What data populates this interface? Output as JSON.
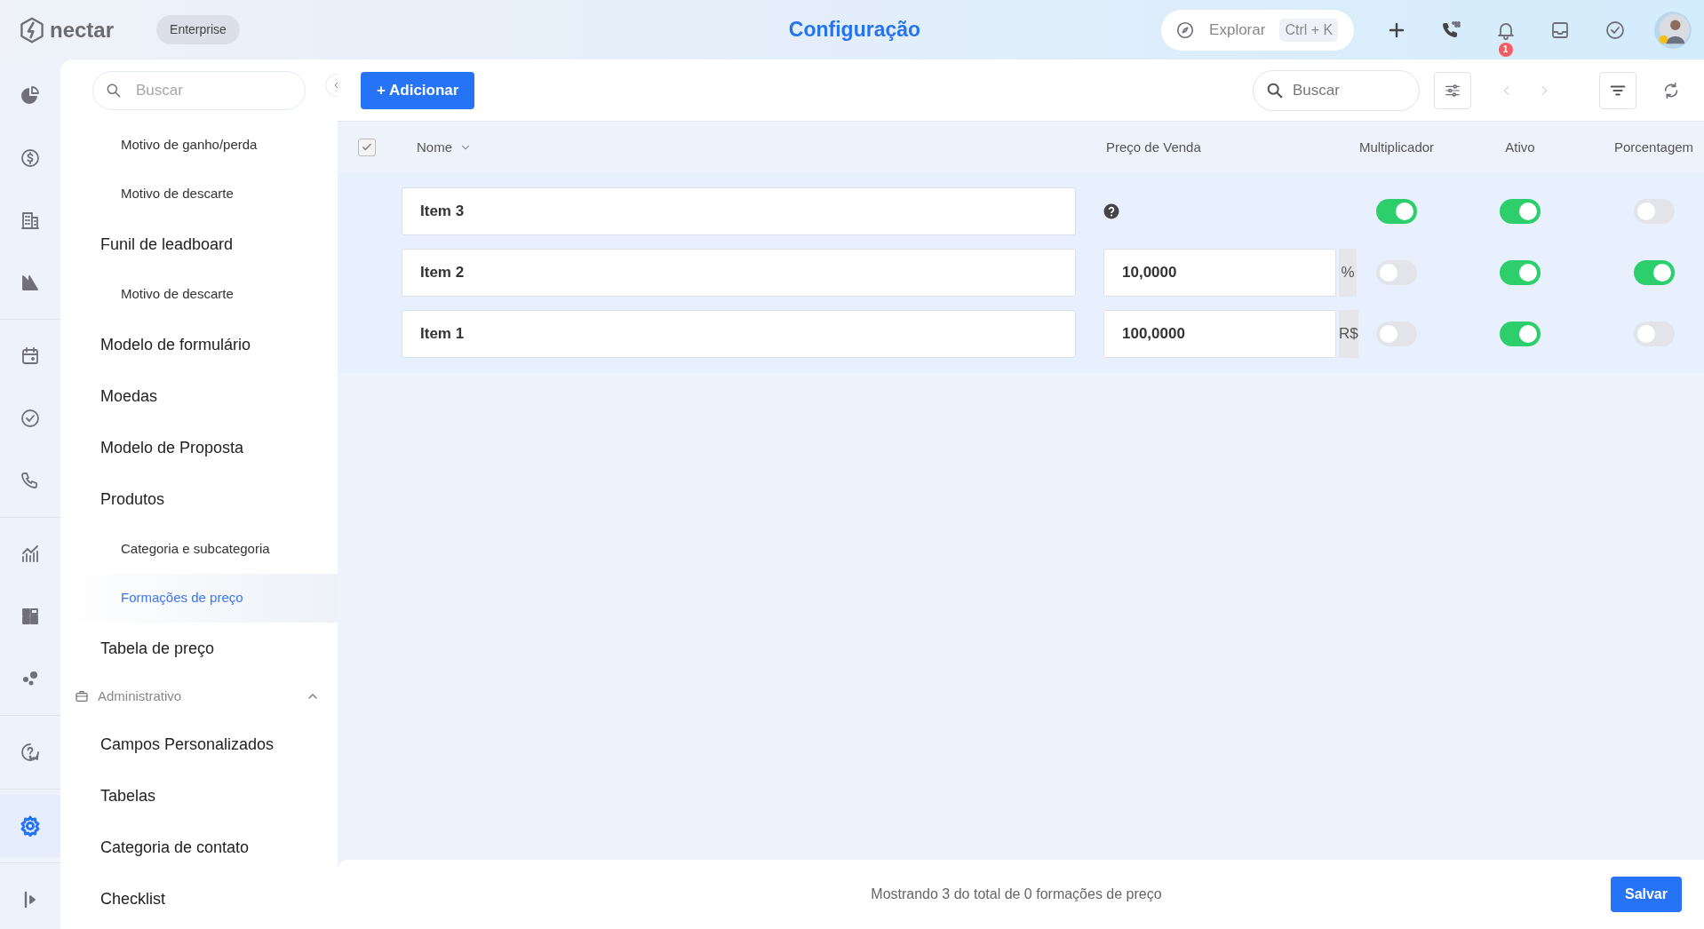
{
  "topbar": {
    "brand": "nectar",
    "plan": "Enterprise",
    "title": "Configuração",
    "explore": {
      "placeholder": "Explorar",
      "shortcut": "Ctrl + K"
    },
    "notifications": "1"
  },
  "rail": [
    [
      {
        "selected": false
      },
      {
        "selected": false
      },
      {
        "selected": false
      },
      {
        "selected": false
      }
    ],
    [
      {
        "selected": false
      },
      {
        "selected": false
      },
      {
        "selected": false
      }
    ],
    [
      {
        "selected": false
      },
      {
        "selected": false
      },
      {
        "selected": false
      }
    ],
    [
      {
        "selected": false
      }
    ],
    [
      {
        "selected": true
      }
    ],
    [
      {
        "selected": false
      }
    ]
  ],
  "sidebar": {
    "search": {
      "placeholder": "Buscar"
    },
    "items": [
      {
        "kind": "sub",
        "label": "Motivo de ganho/perda",
        "selected": false
      },
      {
        "kind": "sub",
        "label": "Motivo de descarte",
        "selected": false
      },
      {
        "kind": "main",
        "label": "Funil de leadboard",
        "selected": false
      },
      {
        "kind": "sub",
        "label": "Motivo de descarte",
        "selected": false
      },
      {
        "kind": "main",
        "label": "Modelo de formulário",
        "selected": false
      },
      {
        "kind": "main",
        "label": "Moedas",
        "selected": false
      },
      {
        "kind": "main",
        "label": "Modelo de Proposta",
        "selected": false
      },
      {
        "kind": "main",
        "label": "Produtos",
        "selected": false
      },
      {
        "kind": "sub",
        "label": "Categoria e subcategoria",
        "selected": false
      },
      {
        "kind": "sub",
        "label": "Formações de preço",
        "selected": true
      },
      {
        "kind": "main",
        "label": "Tabela de preço",
        "selected": false
      },
      {
        "kind": "section",
        "label": "Administrativo",
        "expanded": true
      },
      {
        "kind": "main",
        "label": "Campos Personalizados",
        "selected": false
      },
      {
        "kind": "main",
        "label": "Tabelas",
        "selected": false
      },
      {
        "kind": "main",
        "label": "Categoria de contato",
        "selected": false
      },
      {
        "kind": "main",
        "label": "Checklist",
        "selected": false
      }
    ]
  },
  "toolbar": {
    "add": "+ Adicionar",
    "search": {
      "placeholder": "Buscar"
    }
  },
  "table": {
    "select_all": {
      "checked": true
    },
    "columns": [
      "Nome",
      "Preço de Venda",
      "Multiplicador",
      "Ativo",
      "Porcentagem"
    ],
    "rows": [
      {
        "name": "Item 3",
        "multiplier": true,
        "active": true,
        "percentage": false
      },
      {
        "name": "Item 2",
        "price": "10,0000",
        "unit": "%",
        "multiplier": false,
        "active": true,
        "percentage": true
      },
      {
        "name": "Item 1",
        "price": "100,0000",
        "unit": "R$",
        "multiplier": false,
        "active": true,
        "percentage": false
      }
    ]
  },
  "footer": {
    "summary": "Mostrando 3 do total de 0 formações de preço",
    "save": "Salvar"
  }
}
